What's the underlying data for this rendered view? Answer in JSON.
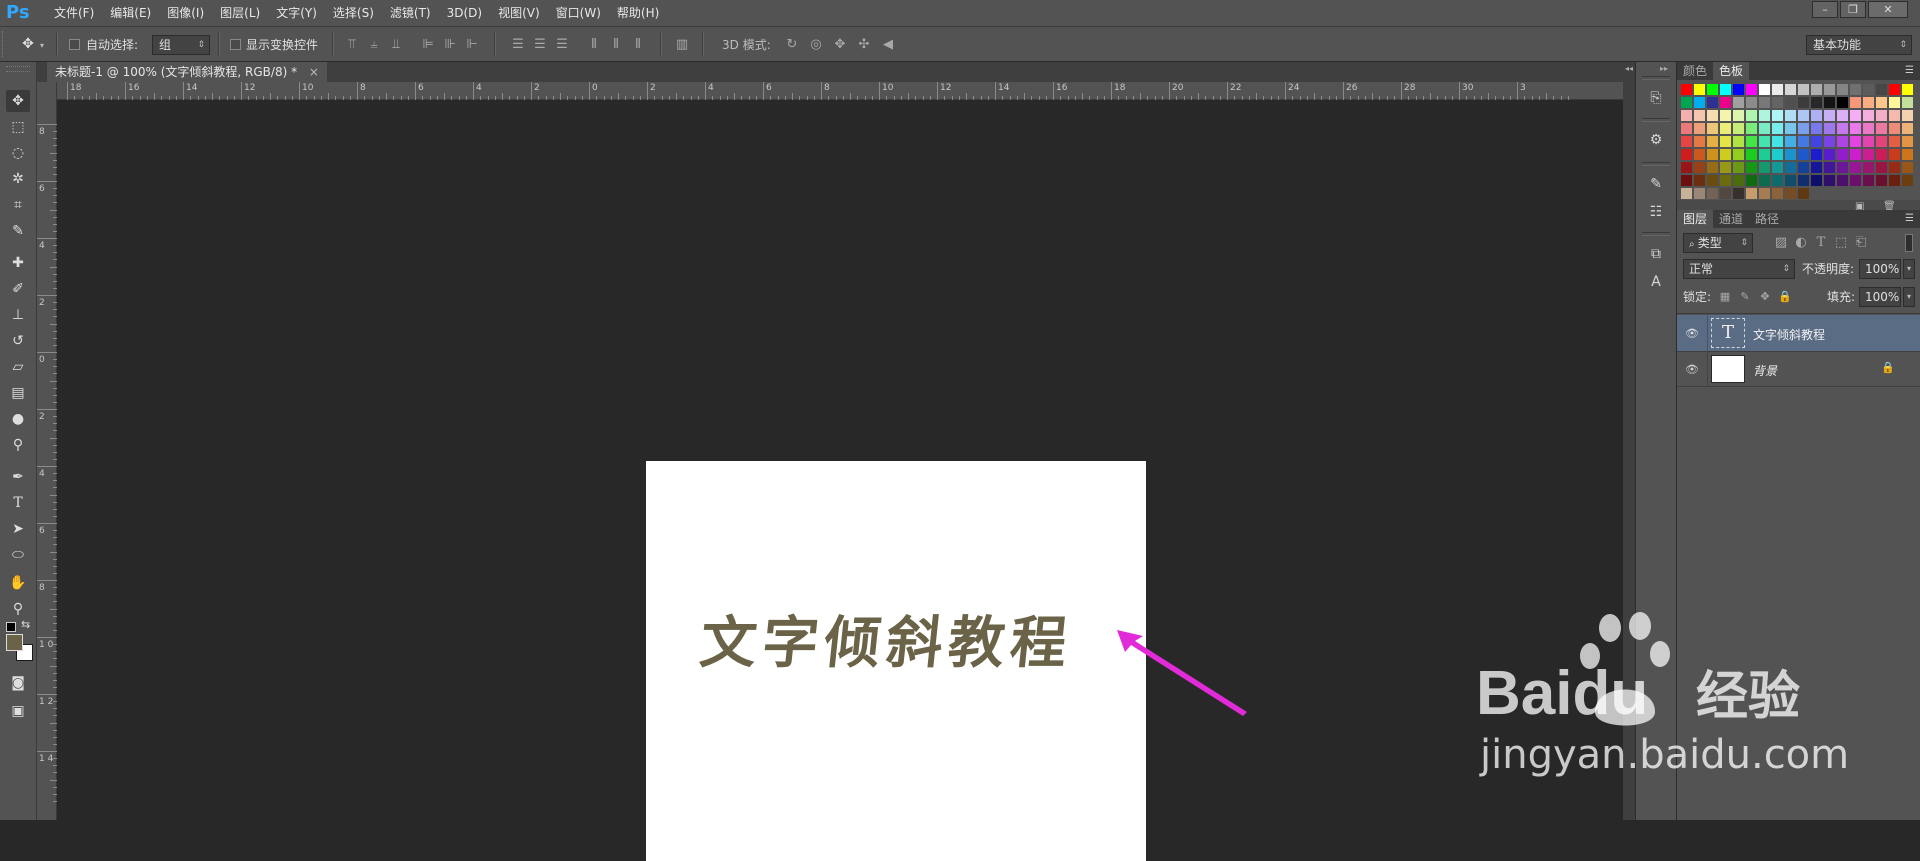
{
  "app": {
    "logo": "Ps"
  },
  "menubar": {
    "items": [
      "文件(F)",
      "编辑(E)",
      "图像(I)",
      "图层(L)",
      "文字(Y)",
      "选择(S)",
      "滤镜(T)",
      "3D(D)",
      "视图(V)",
      "窗口(W)",
      "帮助(H)"
    ],
    "window_buttons": [
      "–",
      "❐",
      "✕"
    ]
  },
  "options": {
    "auto_select_label": "自动选择:",
    "auto_select_value": "组",
    "show_transform_label": "显示变换控件",
    "mode_3d_label": "3D 模式:",
    "workspace_value": "基本功能"
  },
  "document": {
    "tab_title": "未标题-1 @ 100% (文字倾斜教程, RGB/8) *",
    "tab_close": "×",
    "canvas_text": "文字倾斜教程",
    "ruler_top_labels": [
      "18",
      "16",
      "14",
      "12",
      "10",
      "8",
      "6",
      "4",
      "2",
      "0",
      "2",
      "4",
      "6",
      "8",
      "10",
      "12",
      "14",
      "16",
      "18",
      "20",
      "22",
      "24",
      "26",
      "28",
      "30",
      "3"
    ],
    "ruler_left_labels": [
      "8",
      "6",
      "4",
      "2",
      "0",
      "2",
      "4",
      "6",
      "8",
      "1 0",
      "1 2",
      "1 4"
    ]
  },
  "panels": {
    "color_tabs": [
      "颜色",
      "色板"
    ],
    "layers_tabs": [
      "图层",
      "通道",
      "路径"
    ],
    "filter_kind": "类型",
    "blend_mode": "正常",
    "opacity_label": "不透明度:",
    "opacity_value": "100%",
    "lock_label": "锁定:",
    "fill_label": "填充:",
    "fill_value": "100%",
    "layers": [
      {
        "name": "文字倾斜教程",
        "type": "text",
        "thumb": "T",
        "visible": true,
        "selected": true
      },
      {
        "name": "背景",
        "type": "background",
        "visible": true,
        "locked": true
      }
    ]
  },
  "watermark": {
    "brand": "Baidu",
    "brand_cn": "经验",
    "url": "jingyan.baidu.com"
  },
  "colors": {
    "ui_panel": "#535353",
    "workspace": "#282828",
    "canvas": "#ffffff",
    "text_fill": "#6a6347",
    "arrow": "#e22bd8",
    "selected_layer": "#5a6b84",
    "ps_blue": "#31a8ff"
  }
}
